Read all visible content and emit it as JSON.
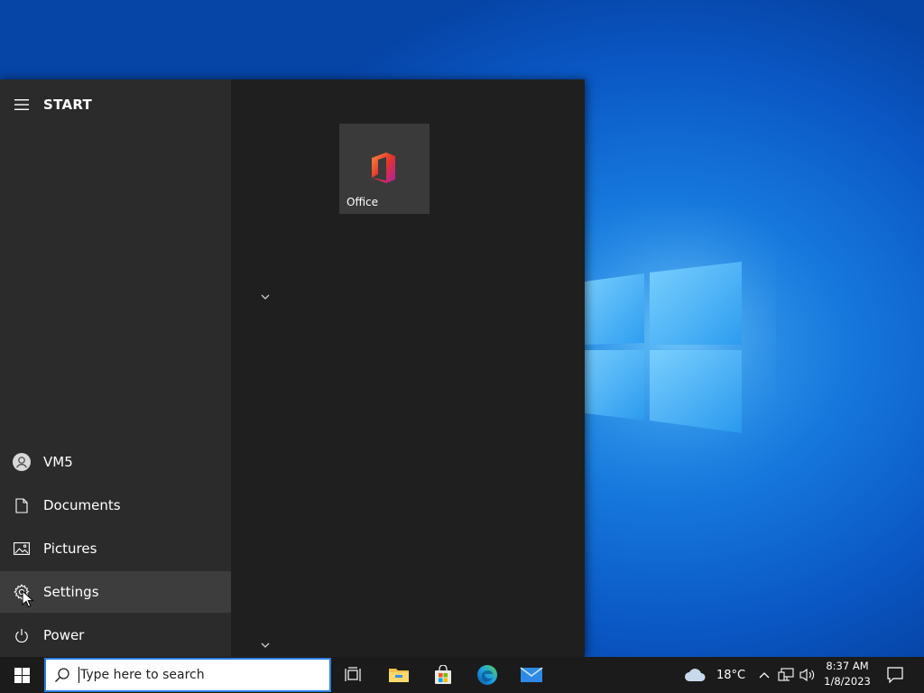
{
  "start_menu": {
    "title": "START",
    "user": "VM5",
    "items": [
      {
        "label": "Documents",
        "icon": "document-icon"
      },
      {
        "label": "Pictures",
        "icon": "pictures-icon"
      },
      {
        "label": "Settings",
        "icon": "gear-icon",
        "highlighted": true
      },
      {
        "label": "Power",
        "icon": "power-icon"
      }
    ],
    "tiles": [
      {
        "label": "Office",
        "icon": "office-icon"
      }
    ]
  },
  "taskbar": {
    "search_placeholder": "Type here to search",
    "apps": [
      "task-view-icon",
      "file-explorer-icon",
      "microsoft-store-icon",
      "edge-icon",
      "mail-icon"
    ],
    "weather": "18°C",
    "time": "8:37 AM",
    "date": "1/8/2023"
  },
  "colors": {
    "accent": "#2b7de0",
    "menu_bg": "#1f1f1f",
    "rail_bg": "#2b2b2b",
    "taskbar_bg": "#1b1b1b"
  }
}
